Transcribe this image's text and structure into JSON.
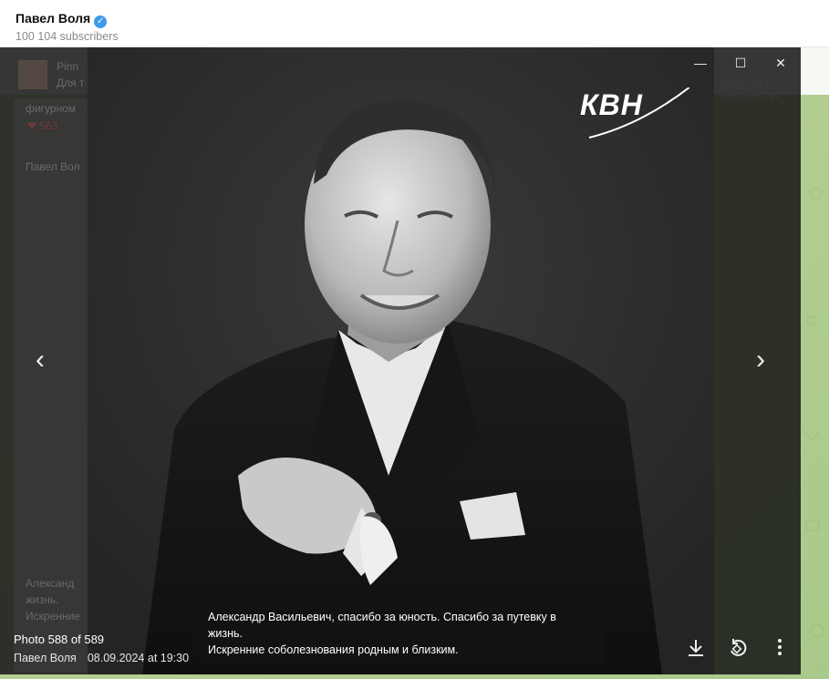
{
  "header": {
    "title": "Павел Воля",
    "subtitle": "100 104 subscribers"
  },
  "background": {
    "sender_name": "Pinn",
    "snippet_left": "Для т",
    "snippet_right": "есяц, но в каждом гор",
    "word": "фигурном",
    "reaction_count": "563",
    "post_author": "Павел Вол",
    "lines": [
      "Александ",
      "жизнь.",
      "Искренние"
    ]
  },
  "viewer": {
    "counter": "Photo 588 of 589",
    "author": "Павел Воля",
    "date": "08.09.2024 at 19:30",
    "logo_text": "КВН",
    "caption_line1": "Александр Васильевич, спасибо за юность. Спасибо за путевку в жизнь.",
    "caption_line2": "Искренние соболезнования родным и близким.",
    "icons": {
      "minimize": "minimize-icon",
      "maximize": "maximize-icon",
      "close": "close-icon",
      "prev": "chevron-left-icon",
      "next": "chevron-right-icon",
      "download": "download-icon",
      "rotate": "rotate-icon",
      "more": "more-vertical-icon"
    }
  },
  "colors": {
    "verified": "#3d9be9",
    "overlay": "#161616",
    "chat_background": "#b6cf92"
  }
}
